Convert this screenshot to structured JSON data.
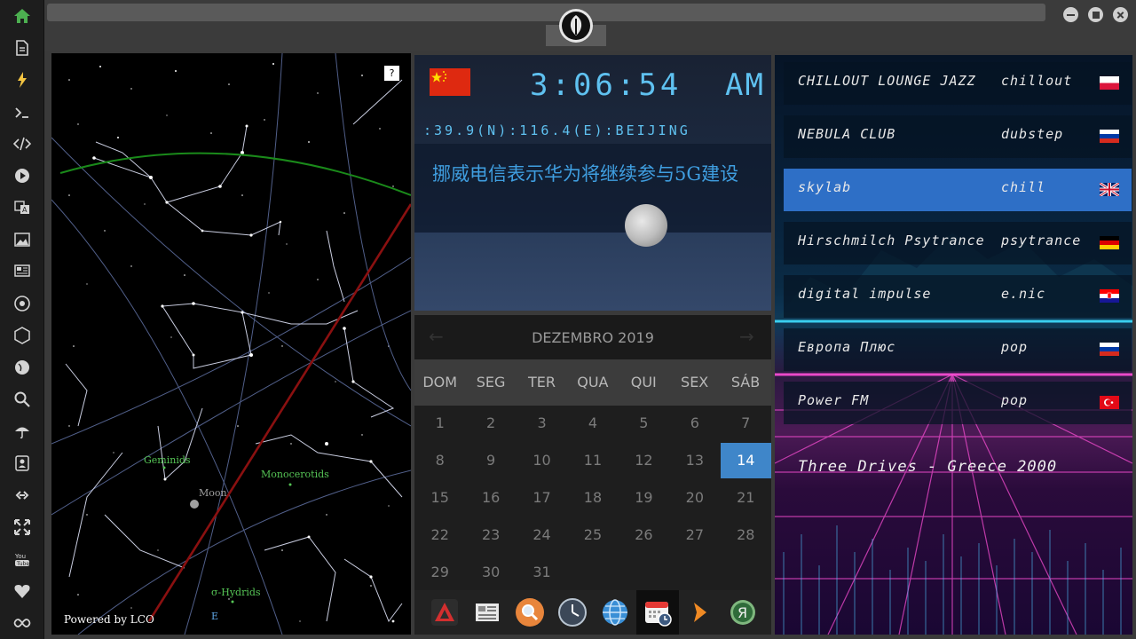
{
  "sidebar": {
    "icons": [
      "home-icon",
      "document-icon",
      "bolt-icon",
      "terminal-icon",
      "code-icon",
      "play-icon",
      "translate-icon",
      "image-icon",
      "news-icon",
      "rebel-icon",
      "hexagon-icon",
      "globe-icon",
      "search-icon",
      "umbrella-icon",
      "contacts-icon",
      "link-icon",
      "expand-icon",
      "youtube-icon",
      "heart-icon",
      "infinity-icon"
    ],
    "active_color": "#4caf50"
  },
  "skymap": {
    "help_label": "?",
    "powered_by": "Powered by LCO",
    "labels": {
      "geminids": "Geminids",
      "moon": "Moon",
      "monocerotids": "Monocerotids",
      "hydrids": "σ-Hydrids",
      "east": "E"
    }
  },
  "clock": {
    "time": "3:06:54",
    "ampm": "AM",
    "coords": ":39.9(N):116.4(E):BEIJING",
    "headline": "挪威电信表示华为将继续参与5G建设",
    "flag": "china-flag"
  },
  "calendar": {
    "title": "DEZEMBRO 2019",
    "prev": "←",
    "next": "→",
    "weekdays": [
      "DOM",
      "SEG",
      "TER",
      "QUA",
      "QUI",
      "SEX",
      "SÁB"
    ],
    "days": [
      "1",
      "2",
      "3",
      "4",
      "5",
      "6",
      "7",
      "8",
      "9",
      "10",
      "11",
      "12",
      "13",
      "14",
      "15",
      "16",
      "17",
      "18",
      "19",
      "20",
      "21",
      "22",
      "23",
      "24",
      "25",
      "26",
      "27",
      "28",
      "29",
      "30",
      "31"
    ],
    "today": "14"
  },
  "dock": {
    "apps": [
      "red-app-icon",
      "news-reader-icon",
      "search-app-icon",
      "clock-app-icon",
      "globe-app-icon",
      "calendar-app-icon",
      "play-arrow-icon",
      "yandex-icon"
    ]
  },
  "radio": {
    "stations": [
      {
        "name": "CHILLOUT LOUNGE JAZZ",
        "genre": "chillout",
        "flag": "poland-flag"
      },
      {
        "name": "NEBULA CLUB",
        "genre": "dubstep",
        "flag": "russia-flag"
      },
      {
        "name": "skylab",
        "genre": "chill",
        "flag": "uk-flag"
      },
      {
        "name": "Hirschmilch Psytrance",
        "genre": "psytrance",
        "flag": "germany-flag"
      },
      {
        "name": "digital impulse",
        "genre": "e.nic",
        "flag": "croatia-flag"
      },
      {
        "name": "Европа Плюс",
        "genre": "pop",
        "flag": "russia-flag"
      },
      {
        "name": "Power FM",
        "genre": "pop",
        "flag": "turkey-flag"
      }
    ],
    "now_playing": "Three Drives - Greece 2000"
  }
}
